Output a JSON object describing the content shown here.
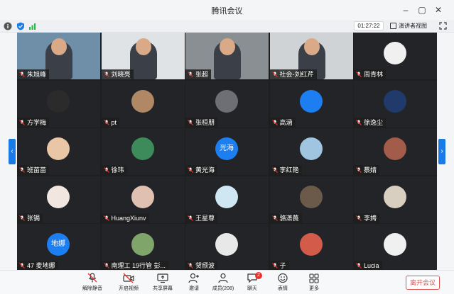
{
  "window": {
    "title": "腾讯会议",
    "min_icon": "minimize-icon",
    "max_icon": "maximize-icon",
    "close_icon": "close-icon"
  },
  "infobar": {
    "timer": "01:27:22",
    "speaker_view_label": "演讲者视图"
  },
  "participants": [
    {
      "name": "朱旭峰",
      "kind": "video"
    },
    {
      "name": "刘晓亮",
      "kind": "video"
    },
    {
      "name": "张超",
      "kind": "video"
    },
    {
      "name": "社会-刘红芹",
      "kind": "video"
    },
    {
      "name": "周青林",
      "kind": "avatar"
    },
    {
      "name": "方学梅",
      "kind": "avatar"
    },
    {
      "name": "pt",
      "kind": "avatar"
    },
    {
      "name": "张桓朋",
      "kind": "avatar"
    },
    {
      "name": "高涵",
      "kind": "avatar"
    },
    {
      "name": "徐逸尘",
      "kind": "avatar"
    },
    {
      "name": "班苗苗",
      "kind": "avatar"
    },
    {
      "name": "徐玮",
      "kind": "avatar"
    },
    {
      "name": "黄光海",
      "kind": "text-avatar",
      "avatar_text": "光海"
    },
    {
      "name": "李红艳",
      "kind": "avatar"
    },
    {
      "name": "蔡婧",
      "kind": "avatar"
    },
    {
      "name": "张锔",
      "kind": "avatar"
    },
    {
      "name": "HuangXiunv",
      "kind": "avatar"
    },
    {
      "name": "王星尊",
      "kind": "avatar"
    },
    {
      "name": "骆潇葨",
      "kind": "avatar"
    },
    {
      "name": "李娉",
      "kind": "avatar"
    },
    {
      "name": "47 麦地娜",
      "kind": "text-avatar",
      "avatar_text": "地娜"
    },
    {
      "name": "南理工 19行管 彭...",
      "kind": "avatar"
    },
    {
      "name": "贺颀波",
      "kind": "avatar"
    },
    {
      "name": "子",
      "kind": "avatar"
    },
    {
      "name": "Lucia",
      "kind": "avatar"
    }
  ],
  "toolbar": {
    "mute_label": "解除静音",
    "video_label": "开启视频",
    "share_label": "共享屏幕",
    "invite_label": "邀请",
    "members_label": "成员(208)",
    "chat_label": "聊天",
    "chat_badge": "2",
    "reactions_label": "表情",
    "more_label": "更多",
    "leave_label": "离开会议"
  },
  "colors": {
    "accent": "#1a7ae8",
    "leave": "#e0514e",
    "grid_bg": "#1d1e20"
  }
}
